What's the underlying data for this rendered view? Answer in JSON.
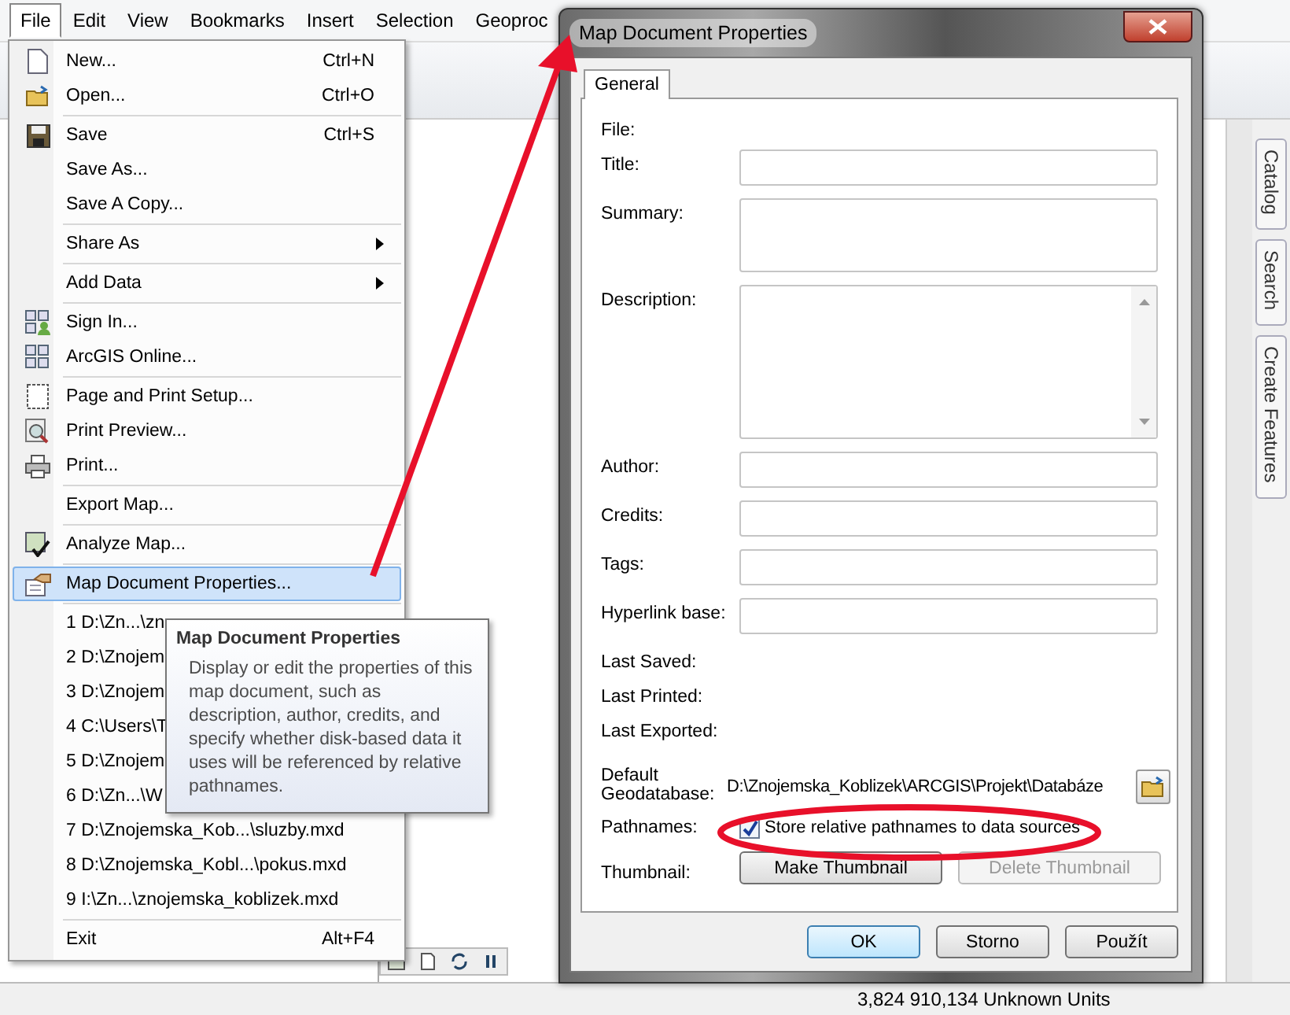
{
  "menu_bar": [
    {
      "label": "File",
      "selected": true
    },
    {
      "label": "Edit",
      "selected": false
    },
    {
      "label": "View",
      "selected": false
    },
    {
      "label": "Bookmarks",
      "selected": false
    },
    {
      "label": "Insert",
      "selected": false
    },
    {
      "label": "Selection",
      "selected": false
    },
    {
      "label": "Geoproc",
      "selected": false
    }
  ],
  "file_menu": {
    "items": [
      {
        "kind": "item",
        "label": "New...",
        "shortcut": "Ctrl+N",
        "highlighted": false
      },
      {
        "kind": "item",
        "label": "Open...",
        "shortcut": "Ctrl+O",
        "highlighted": false
      },
      {
        "kind": "separator"
      },
      {
        "kind": "item",
        "label": "Save",
        "shortcut": "Ctrl+S",
        "highlighted": false
      },
      {
        "kind": "item",
        "label": "Save As...",
        "highlighted": false
      },
      {
        "kind": "item",
        "label": "Save A Copy...",
        "highlighted": false
      },
      {
        "kind": "separator"
      },
      {
        "kind": "submenu",
        "label": "Share As",
        "highlighted": false
      },
      {
        "kind": "separator"
      },
      {
        "kind": "submenu",
        "label": "Add Data",
        "highlighted": false
      },
      {
        "kind": "separator"
      },
      {
        "kind": "item",
        "label": "Sign In...",
        "highlighted": false
      },
      {
        "kind": "item",
        "label": "ArcGIS Online...",
        "highlighted": false
      },
      {
        "kind": "separator"
      },
      {
        "kind": "item",
        "label": "Page and Print Setup...",
        "highlighted": false
      },
      {
        "kind": "item",
        "label": "Print Preview...",
        "highlighted": false
      },
      {
        "kind": "item",
        "label": "Print...",
        "highlighted": false
      },
      {
        "kind": "separator"
      },
      {
        "kind": "item",
        "label": "Export Map...",
        "highlighted": false
      },
      {
        "kind": "separator"
      },
      {
        "kind": "item",
        "label": "Analyze Map...",
        "highlighted": false
      },
      {
        "kind": "separator"
      },
      {
        "kind": "item",
        "label": "Map Document Properties...",
        "highlighted": true
      },
      {
        "kind": "separator"
      },
      {
        "kind": "item",
        "label": "1 D:\\Zn...\\zn",
        "highlighted": false
      },
      {
        "kind": "item",
        "label": "2 D:\\Znojem",
        "highlighted": false
      },
      {
        "kind": "item",
        "label": "3 D:\\Znojem",
        "highlighted": false
      },
      {
        "kind": "item",
        "label": "4 C:\\Users\\T",
        "highlighted": false
      },
      {
        "kind": "item",
        "label": "5 D:\\Znojem",
        "highlighted": false
      },
      {
        "kind": "item",
        "label": "6 D:\\Zn...\\W",
        "highlighted": false
      },
      {
        "kind": "item",
        "label": "7 D:\\Znojemska_Kob...\\sluzby.mxd",
        "highlighted": false
      },
      {
        "kind": "item",
        "label": "8 D:\\Znojemska_Kobl...\\pokus.mxd",
        "highlighted": false
      },
      {
        "kind": "item",
        "label": "9 I:\\Zn...\\znojemska_koblizek.mxd",
        "highlighted": false
      },
      {
        "kind": "separator"
      },
      {
        "kind": "item",
        "label": "Exit",
        "shortcut": "Alt+F4",
        "highlighted": false
      }
    ]
  },
  "tooltip": {
    "title": "Map Document Properties",
    "text": "Display or edit the properties of this map document, such as description, author, credits, and specify whether disk-based data it uses will be referenced by relative pathnames."
  },
  "dialog": {
    "title": "Map Document Properties",
    "tabs": [
      {
        "label": "General",
        "selected": true
      }
    ],
    "fields": [
      {
        "kind": "text",
        "label": "File:"
      },
      {
        "kind": "input",
        "label": "Title:"
      },
      {
        "kind": "area",
        "label": "Summary:"
      },
      {
        "kind": "scroll_area",
        "label": "Description:"
      },
      {
        "kind": "input",
        "label": "Author:"
      },
      {
        "kind": "input",
        "label": "Credits:"
      },
      {
        "kind": "input",
        "label": "Tags:"
      },
      {
        "kind": "input",
        "label": "Hyperlink base:"
      },
      {
        "kind": "text",
        "label": "Last Saved:"
      },
      {
        "kind": "text",
        "label": "Last Printed:"
      },
      {
        "kind": "text",
        "label": "Last Exported:"
      },
      {
        "kind": "path",
        "label": "Default Geodatabase:",
        "value": "D:\\Znojemska_Koblizek\\ARCGIS\\Projekt\\Databáze"
      },
      {
        "kind": "checkbox",
        "label": "Pathnames:",
        "option": "Store relative pathnames to data sources",
        "checked": true
      },
      {
        "kind": "buttons",
        "label": "Thumbnail:",
        "buttons": [
          {
            "label": "Make Thumbnail",
            "disabled": false
          },
          {
            "label": "Delete Thumbnail",
            "disabled": true
          }
        ]
      }
    ],
    "buttons": [
      {
        "label": "OK",
        "default": true
      },
      {
        "label": "Storno",
        "default": false
      },
      {
        "label": "Použít",
        "default": false
      }
    ]
  },
  "side_tabs": [
    "Catalog",
    "Search",
    "Create Features"
  ],
  "status_bar": {
    "coordinates": "3,824  910,134 Unknown Units"
  }
}
